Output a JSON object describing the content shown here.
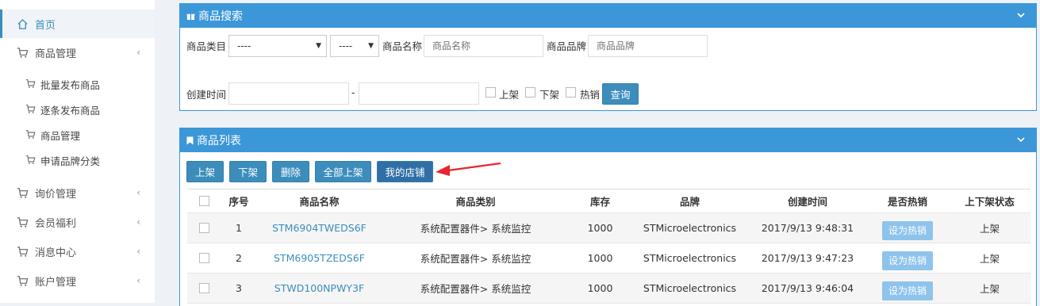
{
  "sidebar": {
    "home": "首页",
    "goods_mgmt": "商品管理",
    "sub_items": [
      "批量发布商品",
      "逐条发布商品",
      "商品管理",
      "申请品牌分类"
    ],
    "inquiry": "询价管理",
    "member": "会员福利",
    "messages": "消息中心",
    "account": "账户管理"
  },
  "search_panel": {
    "title": "商品搜索",
    "category_label": "商品类目",
    "category_value_1": "----",
    "category_value_2": "----",
    "name_label": "商品名称",
    "name_placeholder": "商品名称",
    "brand_label": "商品品牌",
    "brand_placeholder": "商品品牌",
    "created_label": "创建时间",
    "range_sep": "-",
    "on_shelf": "上架",
    "off_shelf": "下架",
    "hot_sale": "热销",
    "query_button": "查询"
  },
  "list_panel": {
    "title": "商品列表",
    "buttons": {
      "on_shelf": "上架",
      "off_shelf": "下架",
      "delete": "删除",
      "all_on_shelf": "全部上架",
      "my_shop": "我的店铺"
    },
    "columns": [
      "序号",
      "商品名称",
      "商品类别",
      "库存",
      "品牌",
      "创建时间",
      "是否热销",
      "上下架状态"
    ],
    "rows": [
      {
        "no": "1",
        "name": "STM6904TWEDS6F",
        "category": "系统配置器件> 系统监控",
        "stock": "1000",
        "brand": "STMicroelectronics",
        "created": "2017/9/13 9:48:31",
        "hot": "设为热销",
        "status": "上架"
      },
      {
        "no": "2",
        "name": "STM6905TZEDS6F",
        "category": "系统配置器件> 系统监控",
        "stock": "1000",
        "brand": "STMicroelectronics",
        "created": "2017/9/13 9:47:23",
        "hot": "设为热销",
        "status": "上架"
      },
      {
        "no": "3",
        "name": "STWD100NPWY3F",
        "category": "系统配置器件> 系统监控",
        "stock": "1000",
        "brand": "STMicroelectronics",
        "created": "2017/9/13 9:46:04",
        "hot": "设为热销",
        "status": "上架"
      }
    ]
  },
  "colors": {
    "accent": "#3c97d9",
    "button": "#3c8dbc",
    "hot_button": "#8ec4ec",
    "annotation_arrow": "#e8262d"
  }
}
